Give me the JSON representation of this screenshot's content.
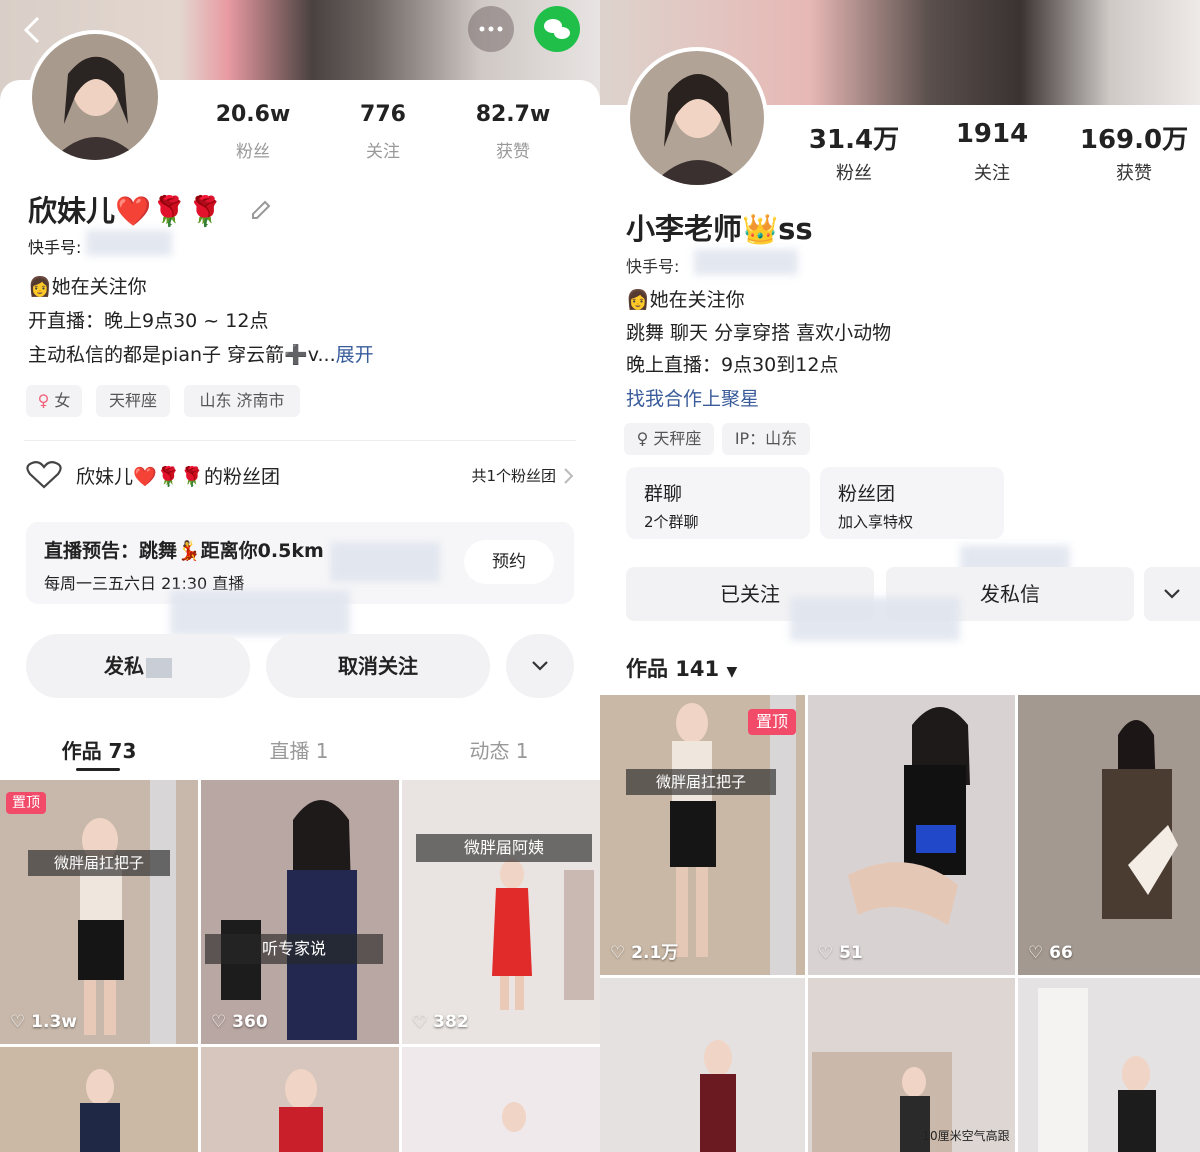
{
  "left": {
    "profile": {
      "followers_count": "20.6w",
      "followers_label": "粉丝",
      "following_count": "776",
      "following_label": "关注",
      "likes_count": "82.7w",
      "likes_label": "获赞",
      "name": "欣妹儿❤️🌹🌹",
      "id_label": "快手号:",
      "status": "她在关注你",
      "bio_line1": "开直播：晚上9点30 ~ 12点",
      "bio_line2": "主动私信的都是pian子 穿云箭➕v...",
      "expand_label": "展开",
      "tags": [
        "女",
        "天秤座",
        "山东 济南市"
      ]
    },
    "fan_group": {
      "title": "欣妹儿❤️🌹🌹的粉丝团",
      "count": "共1个粉丝团"
    },
    "live_notice": {
      "title": "直播预告：跳舞💃距离你0.5km",
      "schedule": "每周一三五六日 21:30 直播",
      "button": "预约"
    },
    "buttons": {
      "message": "发私",
      "unfollow": "取消关注"
    },
    "tabs": [
      "作品 73",
      "直播 1",
      "动态 1"
    ],
    "tiles": [
      {
        "likes": "1.3w",
        "caption": "微胖届扛把子",
        "pinned": "置顶",
        "color": "#c7b8ab"
      },
      {
        "likes": "360",
        "caption": "听专家说",
        "color": "#b9a7a3"
      },
      {
        "likes": "382",
        "caption": "微胖届阿姨",
        "color": "#e9e4e1"
      },
      {
        "color": "#cbb9a5"
      },
      {
        "color": "#d6c6bd"
      },
      {
        "color": "#efe9ec"
      }
    ]
  },
  "right": {
    "profile": {
      "followers_count": "31.4万",
      "followers_label": "粉丝",
      "following_count": "1914",
      "following_label": "关注",
      "likes_count": "169.0万",
      "likes_label": "获赞",
      "name": "小李老师👑ss",
      "id_label": "快手号:",
      "status": "她在关注你",
      "bio_line1": "跳舞 聊天  分享穿搭 喜欢小动物",
      "bio_line2": "晚上直播：9点30到12点",
      "link": "找我合作上聚星",
      "tags": [
        "天秤座",
        "IP：山东"
      ]
    },
    "cards": [
      {
        "title": "群聊",
        "subtitle": "2个群聊"
      },
      {
        "title": "粉丝团",
        "subtitle": "加入享特权"
      }
    ],
    "buttons": {
      "followed": "已关注",
      "message": "发私信"
    },
    "works_label": "作品 141",
    "tiles": [
      {
        "likes": "2.1万",
        "caption": "微胖届扛把子",
        "pinned": "置顶",
        "color": "#c9b8a6"
      },
      {
        "likes": "51",
        "color": "#d9d2d3"
      },
      {
        "likes": "66",
        "color": "#a49990"
      },
      {
        "color": "#e6e1e1"
      },
      {
        "caption": "10厘米空气高跟",
        "color": "#ded6d3"
      },
      {
        "color": "#e4e2e2"
      }
    ]
  }
}
